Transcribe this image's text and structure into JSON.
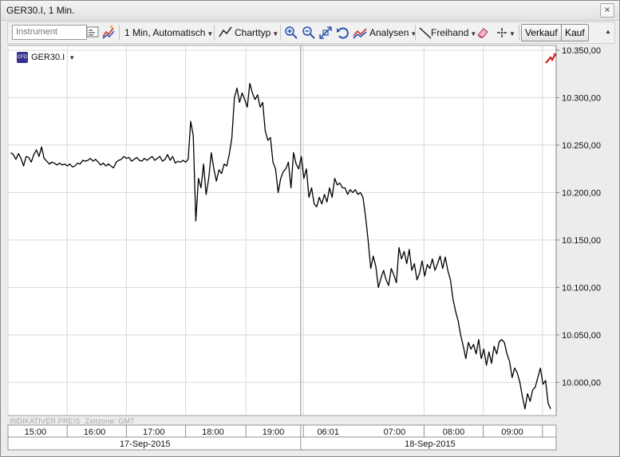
{
  "window": {
    "title": "GER30.I, 1 Min.",
    "close_glyph": "×"
  },
  "toolbar": {
    "instrument_placeholder": "Instrument",
    "interval_label": "1 Min,",
    "mode_label": "Automatisch",
    "charttype_label": "Charttyp",
    "analysen_label": "Analysen",
    "freihand_label": "Freihand",
    "sell_label": "Verkauf",
    "buy_label": "Kauf"
  },
  "chart": {
    "instrument": "GER30.I",
    "cfd_badge": "CFD",
    "footnote_price": "INDIKATIVER PREIS",
    "footnote_tz": "Zeitzone: GMT",
    "colors": {
      "line": "#000000",
      "grid": "#d9d9d9",
      "background": "#ffffff",
      "trend_icon": "#d42020"
    }
  },
  "chart_data": {
    "type": "line",
    "series": [
      {
        "values": [
          10242,
          10240,
          10235,
          10241,
          10236,
          10228,
          10238,
          10237,
          10232,
          10240,
          10245,
          10238,
          10248,
          10236,
          10233,
          10230,
          10232,
          10231,
          10229,
          10231,
          10229,
          10230,
          10228,
          10230,
          10227,
          10228,
          10231,
          10230,
          10234,
          10233,
          10234,
          10236,
          10233,
          10235,
          10232,
          10229,
          10231,
          10228,
          10230,
          10228,
          10226,
          10232,
          10234,
          10235,
          10238,
          10236,
          10237,
          10233,
          10235,
          10237,
          10234,
          10233,
          10236,
          10234,
          10236,
          10238,
          10234,
          10236,
          10238,
          10233,
          10235,
          10240,
          10234,
          10238,
          10231,
          10233,
          10232,
          10234,
          10232,
          10235,
          10275,
          10260,
          10170,
          10215,
          10205,
          10230,
          10198,
          10215,
          10242,
          10225,
          10212,
          10224,
          10220,
          10230,
          10228,
          10240,
          10258,
          10300,
          10310,
          10295,
          10305,
          10298,
          10290,
          10315,
          10305,
          10298,
          10303,
          10290,
          10295,
          10265,
          10255,
          10258,
          10232,
          10225,
          10200,
          10215,
          10222,
          10225,
          10232,
          10205,
          10242,
          10230,
          10225,
          10238,
          10215,
          10225,
          10195,
          10205,
          10188,
          10185,
          10195,
          10188,
          10198,
          10190,
          10205,
          10195,
          10215,
          10208,
          10210,
          10205,
          10205,
          10198,
          10203,
          10200,
          10203,
          10198,
          10200,
          10195,
          10175,
          10150,
          10120,
          10133,
          10122,
          10100,
          10110,
          10118,
          10108,
          10102,
          10120,
          10113,
          10105,
          10142,
          10130,
          10138,
          10125,
          10140,
          10118,
          10125,
          10108,
          10115,
          10128,
          10112,
          10124,
          10120,
          10130,
          10118,
          10125,
          10133,
          10120,
          10132,
          10118,
          10108,
          10088,
          10075,
          10065,
          10050,
          10038,
          10025,
          10042,
          10035,
          10040,
          10030,
          10045,
          10025,
          10035,
          10018,
          10032,
          10020,
          10038,
          10030,
          10043,
          10045,
          10042,
          10030,
          10022,
          10005,
          10015,
          10010,
          10000,
          9985,
          9972,
          9988,
          9980,
          9992,
          9995,
          10005,
          10015,
          9998,
          10002,
          9978,
          9972
        ]
      }
    ],
    "ylim": [
      9965,
      10355
    ],
    "y_ticks": [
      10350,
      10300,
      10250,
      10200,
      10150,
      10100,
      10050,
      10000
    ],
    "y_tick_labels": [
      "10.350,00",
      "10.300,00",
      "10.250,00",
      "10.200,00",
      "10.150,00",
      "10.100,00",
      "10.050,00",
      "10.000,00"
    ],
    "x_ticks": [
      {
        "label": "15:00",
        "frac": 0.05
      },
      {
        "label": "16:00",
        "frac": 0.158
      },
      {
        "label": "17:00",
        "frac": 0.266
      },
      {
        "label": "18:00",
        "frac": 0.374
      },
      {
        "label": "19:00",
        "frac": 0.484
      },
      {
        "label": "06:01",
        "frac": 0.584
      },
      {
        "label": "07:00",
        "frac": 0.705
      },
      {
        "label": "08:00",
        "frac": 0.813
      },
      {
        "label": "09:00",
        "frac": 0.92
      }
    ],
    "x_grid_fracs": [
      0.0,
      0.108,
      0.216,
      0.324,
      0.434,
      0.534,
      0.539,
      0.759,
      0.867,
      0.975
    ],
    "session_break_frac": 0.534,
    "dates": [
      {
        "label": "17-Sep-2015",
        "frac": 0.25
      },
      {
        "label": "18-Sep-2015",
        "frac": 0.77
      }
    ],
    "grid": true
  }
}
